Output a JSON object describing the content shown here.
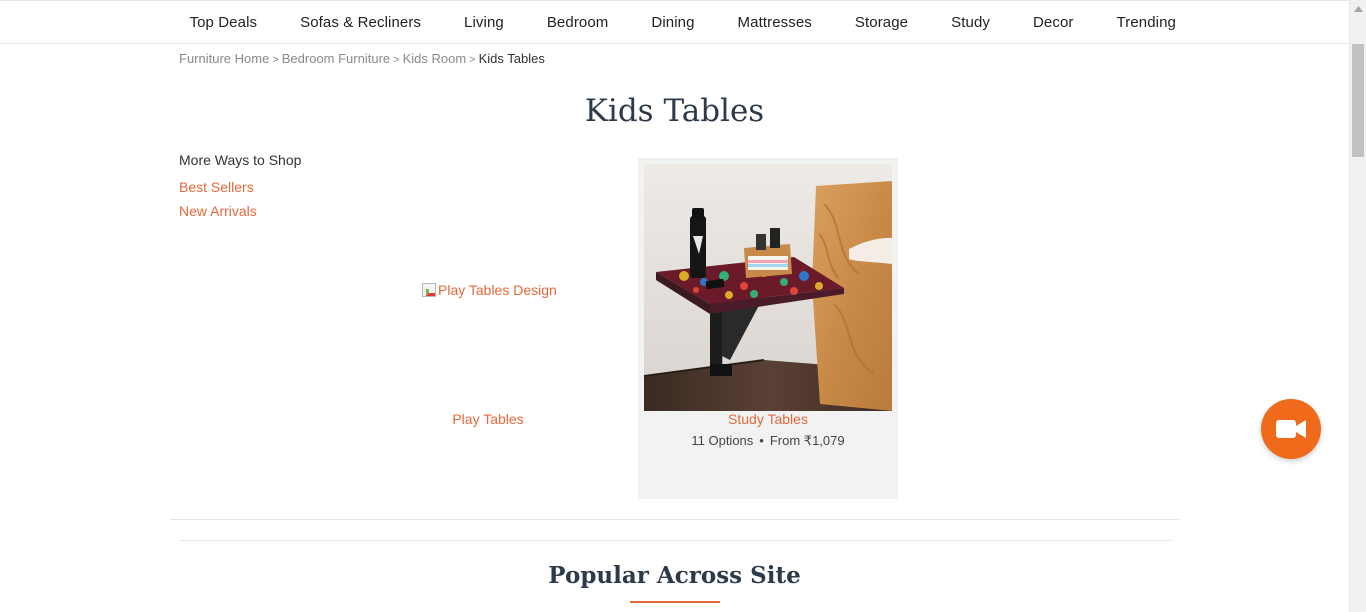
{
  "nav": {
    "items": [
      "Top Deals",
      "Sofas & Recliners",
      "Living",
      "Bedroom",
      "Dining",
      "Mattresses",
      "Storage",
      "Study",
      "Decor",
      "Trending"
    ]
  },
  "breadcrumb": {
    "items": [
      "Furniture Home",
      "Bedroom Furniture",
      "Kids Room"
    ],
    "current": "Kids Tables",
    "separator": ">"
  },
  "page": {
    "title": "Kids Tables"
  },
  "sidebar": {
    "title": "More Ways to Shop",
    "links": [
      "Best Sellers",
      "New Arrivals"
    ]
  },
  "categories": [
    {
      "label": "Play Tables",
      "image_alt": "Play Tables Design"
    },
    {
      "label": "Study Tables",
      "options": "11 Options",
      "dot": "•",
      "price": "From ₹1,079"
    }
  ],
  "popular": {
    "title": "Popular Across Site"
  },
  "colors": {
    "accent": "#e5683a",
    "fab": "#f06a1c",
    "heading": "#2d3a4a"
  },
  "icons": {
    "fab": "video-camera-icon",
    "scroll_up": "arrow-up-icon"
  }
}
